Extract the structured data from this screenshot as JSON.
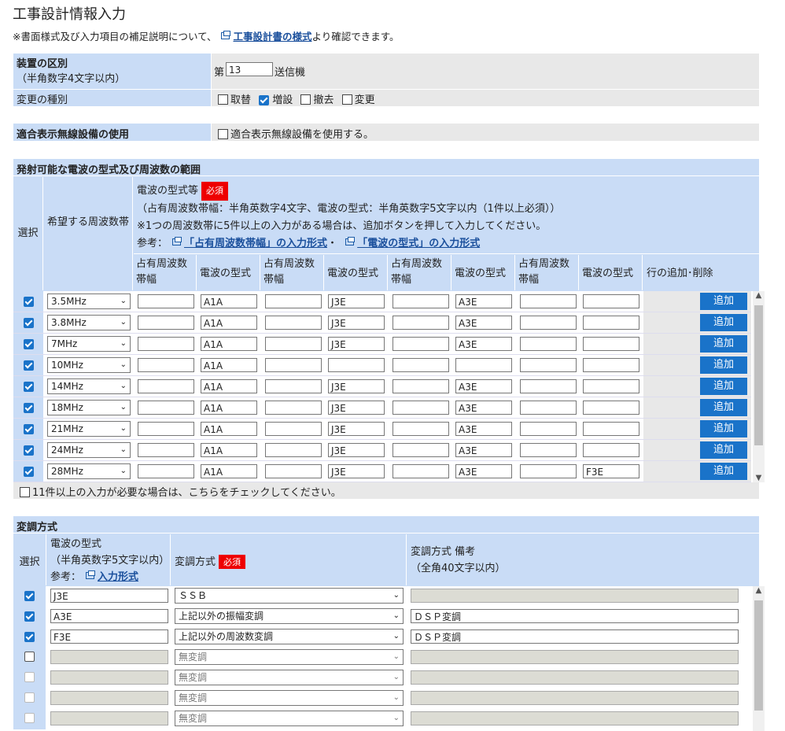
{
  "page": {
    "title": "工事設計情報入力",
    "note_pre": "※書面様式及び入力項目の補足説明について、",
    "note_link": "工事設計書の様式",
    "note_post": "より確認できます。"
  },
  "device": {
    "label": "装置の区別",
    "hint": "（半角数字4文字以内）",
    "prefix": "第",
    "number": "13",
    "suffix": "送信機"
  },
  "change": {
    "label": "変更の種別",
    "options": [
      {
        "label": "取替",
        "checked": false
      },
      {
        "label": "増設",
        "checked": true
      },
      {
        "label": "撤去",
        "checked": false
      },
      {
        "label": "変更",
        "checked": false
      }
    ]
  },
  "conform": {
    "label": "適合表示無線設備の使用",
    "checkbox_label": "適合表示無線設備を使用する。"
  },
  "emission": {
    "section_title": "発射可能な電波の型式及び周波数の範囲",
    "col_select": "選択",
    "col_band": "希望する周波数帯",
    "type_title": "電波の型式等",
    "required": "必須",
    "desc1": "（占有周波数帯幅：半角英数字4文字、電波の型式：半角英数字5文字以内（1件以上必須））",
    "desc2": "※1つの周波数帯に5件以上の入力がある場合は、追加ボタンを押して入力してください。",
    "ref_label": "参考：",
    "ref_link1": "「占有周波数帯幅」の入力形式",
    "ref_sep": "・",
    "ref_link2": "「電波の型式」の入力形式",
    "sub_bw": "占有周波数帯幅",
    "sub_type": "電波の型式",
    "col_addrm": "行の追加･削除",
    "add_label": "追加",
    "rows": [
      {
        "band": "3.5MHz",
        "cells": [
          "",
          "A1A",
          "",
          "J3E",
          "",
          "A3E",
          "",
          ""
        ]
      },
      {
        "band": "3.8MHz",
        "cells": [
          "",
          "A1A",
          "",
          "J3E",
          "",
          "A3E",
          "",
          ""
        ]
      },
      {
        "band": "7MHz",
        "cells": [
          "",
          "A1A",
          "",
          "J3E",
          "",
          "A3E",
          "",
          ""
        ]
      },
      {
        "band": "10MHz",
        "cells": [
          "",
          "A1A",
          "",
          "",
          "",
          "",
          "",
          ""
        ]
      },
      {
        "band": "14MHz",
        "cells": [
          "",
          "A1A",
          "",
          "J3E",
          "",
          "A3E",
          "",
          ""
        ]
      },
      {
        "band": "18MHz",
        "cells": [
          "",
          "A1A",
          "",
          "J3E",
          "",
          "A3E",
          "",
          ""
        ]
      },
      {
        "band": "21MHz",
        "cells": [
          "",
          "A1A",
          "",
          "J3E",
          "",
          "A3E",
          "",
          ""
        ]
      },
      {
        "band": "24MHz",
        "cells": [
          "",
          "A1A",
          "",
          "J3E",
          "",
          "A3E",
          "",
          ""
        ]
      },
      {
        "band": "28MHz",
        "cells": [
          "",
          "A1A",
          "",
          "J3E",
          "",
          "A3E",
          "",
          "F3E"
        ]
      }
    ],
    "overflow_label": "11件以上の入力が必要な場合は、こちらをチェックしてください。"
  },
  "modulation": {
    "section_title": "変調方式",
    "col_select": "選択",
    "col_type1": "電波の型式",
    "col_type2": "（半角英数字5文字以内）",
    "col_type_ref": "参考：",
    "col_type_link": "入力形式",
    "col_method": "変調方式",
    "required": "必須",
    "col_note1": "変調方式 備考",
    "col_note2": "（全角40文字以内）",
    "rows": [
      {
        "checked": true,
        "enabled": true,
        "type": "J3E",
        "method": "ＳＳＢ",
        "note": "",
        "note_enabled": false
      },
      {
        "checked": true,
        "enabled": true,
        "type": "A3E",
        "method": "上記以外の振幅変調",
        "note": "ＤＳＰ変調",
        "note_enabled": true
      },
      {
        "checked": true,
        "enabled": true,
        "type": "F3E",
        "method": "上記以外の周波数変調",
        "note": "ＤＳＰ変調",
        "note_enabled": true
      },
      {
        "checked": false,
        "enabled": true,
        "type": "",
        "method": "無変調",
        "note": "",
        "note_enabled": false
      },
      {
        "checked": false,
        "enabled": false,
        "type": "",
        "method": "無変調",
        "note": "",
        "note_enabled": false
      },
      {
        "checked": false,
        "enabled": false,
        "type": "",
        "method": "無変調",
        "note": "",
        "note_enabled": false
      },
      {
        "checked": false,
        "enabled": false,
        "type": "",
        "method": "無変調",
        "note": "",
        "note_enabled": false
      }
    ]
  }
}
